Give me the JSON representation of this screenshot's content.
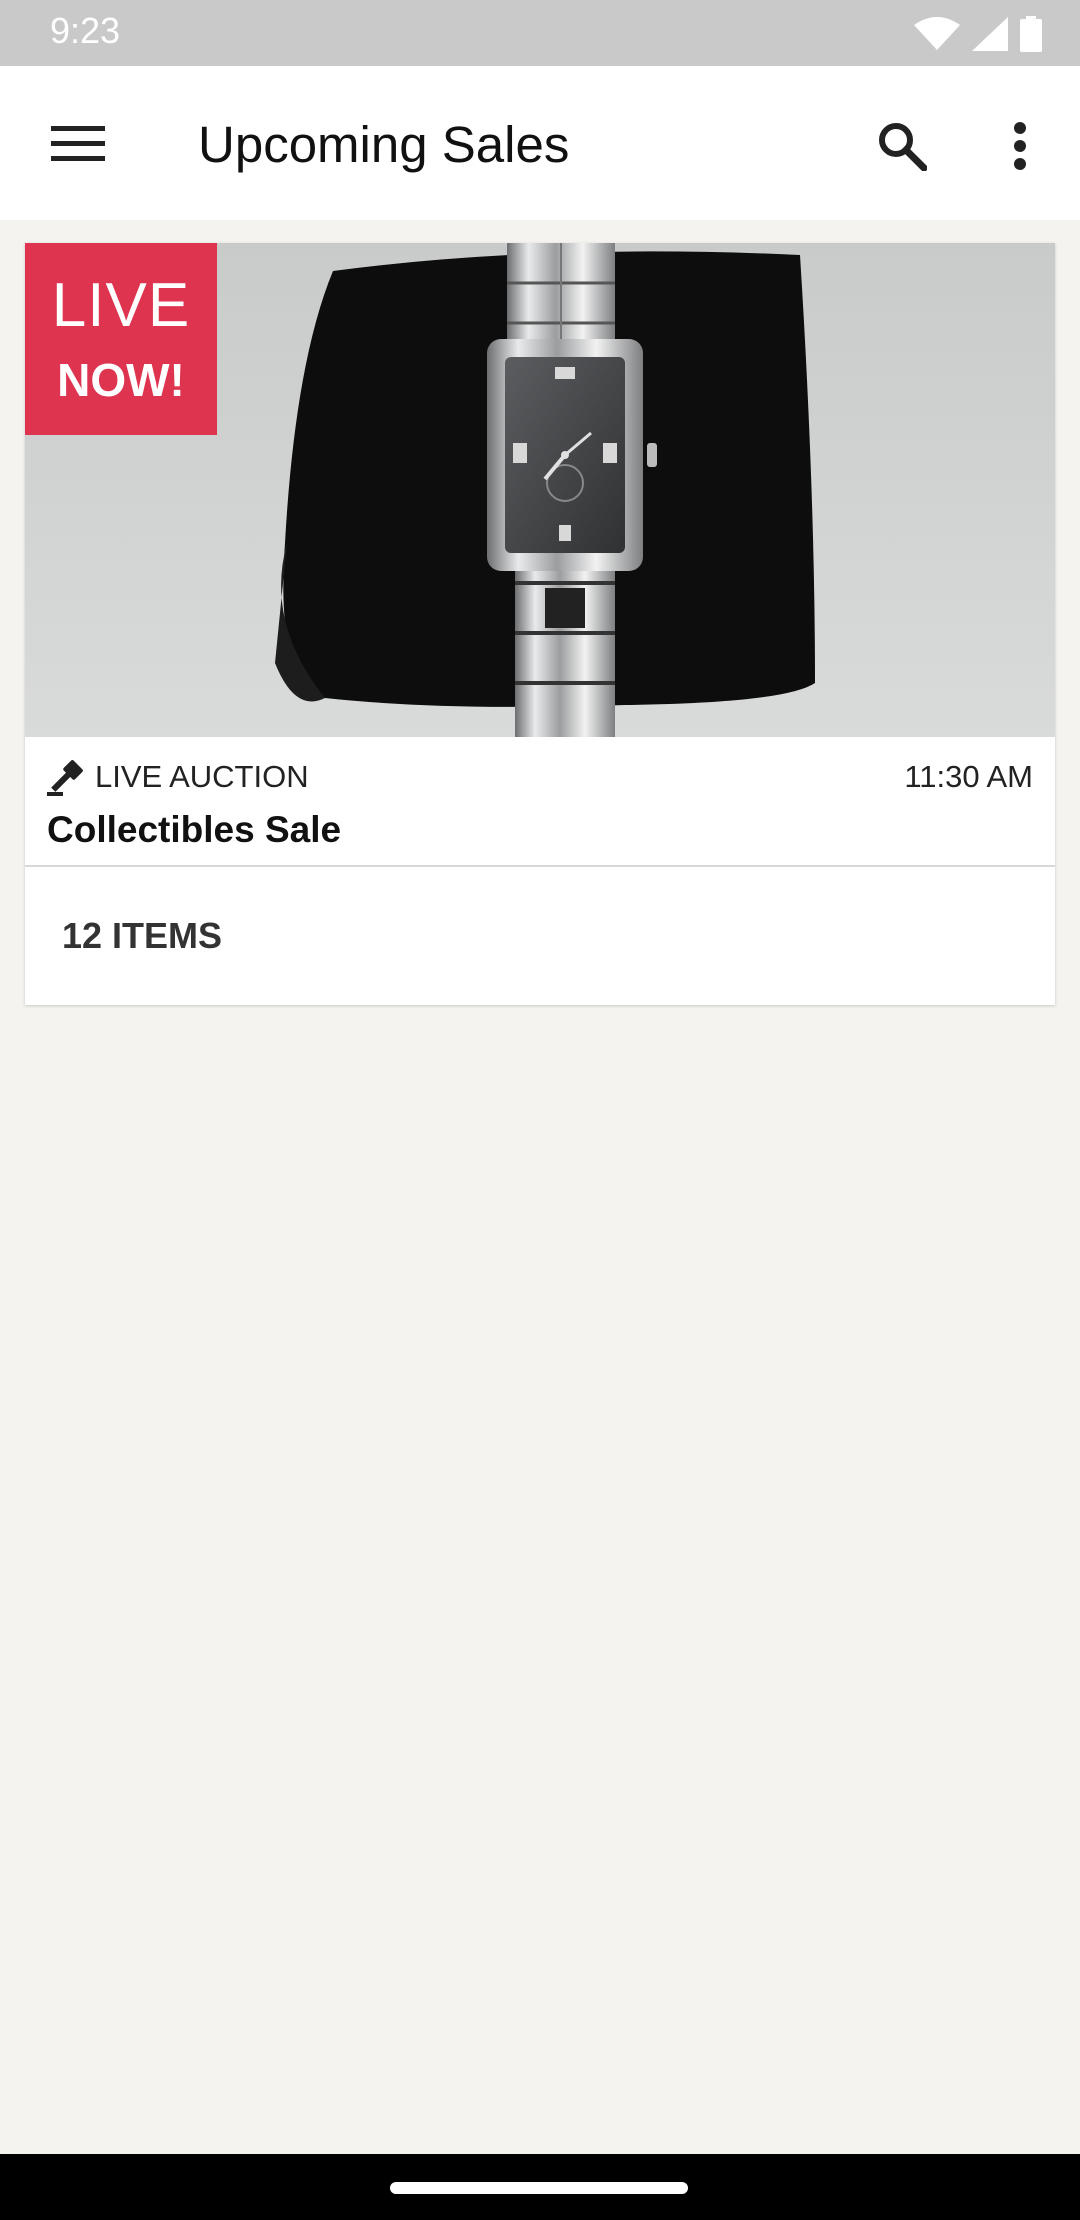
{
  "status_bar": {
    "time": "9:23",
    "icons": [
      "wifi-icon",
      "signal-icon",
      "battery-icon"
    ]
  },
  "app_bar": {
    "title": "Upcoming Sales",
    "icons": [
      "menu-icon",
      "search-icon",
      "more-vert-icon"
    ]
  },
  "sale_card": {
    "badge_line1": "LIVE",
    "badge_line2": "NOW!",
    "type_icon": "gavel-icon",
    "type": "LIVE AUCTION",
    "time": "11:30 AM",
    "title": "Collectibles Sale",
    "items": "12 ITEMS"
  },
  "colors": {
    "badge": "#de3450",
    "background": "#f4f3f0",
    "status_bar": "#c9c9c9",
    "nav_bar": "#000000"
  }
}
